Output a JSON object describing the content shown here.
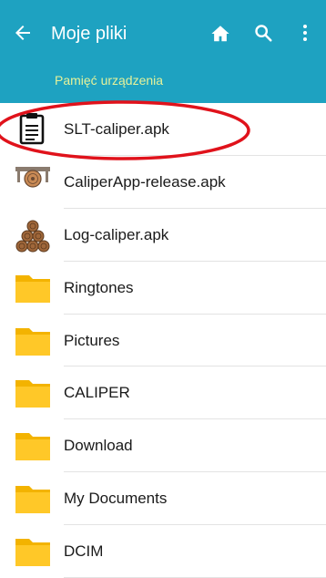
{
  "app_bar": {
    "title": "Moje pliki",
    "breadcrumb": "Pamięć urządzenia",
    "color": "#1ea2c1",
    "icons": [
      "back-arrow-icon",
      "home-icon",
      "search-icon",
      "more-vert-icon"
    ]
  },
  "files": [
    {
      "name": "SLT-caliper.apk",
      "icon": "clipboard-app-icon",
      "type": "apk"
    },
    {
      "name": "CaliperApp-release.apk",
      "icon": "caliper-app-icon",
      "type": "apk"
    },
    {
      "name": "Log-caliper.apk",
      "icon": "log-pile-app-icon",
      "type": "apk"
    },
    {
      "name": "Ringtones",
      "icon": "folder-icon",
      "type": "folder"
    },
    {
      "name": "Pictures",
      "icon": "folder-icon",
      "type": "folder"
    },
    {
      "name": "CALIPER",
      "icon": "folder-icon",
      "type": "folder"
    },
    {
      "name": "Download",
      "icon": "folder-icon",
      "type": "folder"
    },
    {
      "name": "My Documents",
      "icon": "folder-icon",
      "type": "folder"
    },
    {
      "name": "DCIM",
      "icon": "folder-icon",
      "type": "folder"
    }
  ],
  "highlight": {
    "target": "SLT-caliper.apk",
    "color": "#e0121b"
  }
}
